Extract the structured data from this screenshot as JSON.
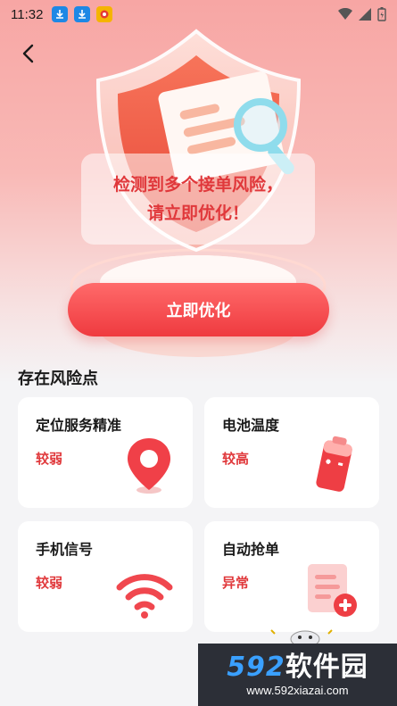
{
  "status_bar": {
    "time": "11:32",
    "icons": [
      "download-icon",
      "download-icon",
      "app-icon",
      "wifi-icon",
      "signal-icon",
      "battery-icon"
    ]
  },
  "hero": {
    "warning_line1": "检测到多个接单风险，",
    "warning_line2": "请立即优化！",
    "cta_label": "立即优化"
  },
  "section": {
    "title": "存在风险点"
  },
  "cards": [
    {
      "title": "定位服务精准",
      "status": "较弱",
      "icon": "location-pin-icon"
    },
    {
      "title": "电池温度",
      "status": "较高",
      "icon": "battery-icon"
    },
    {
      "title": "手机信号",
      "status": "较弱",
      "icon": "wifi-signal-icon"
    },
    {
      "title": "自动抢单",
      "status": "异常",
      "icon": "document-add-icon"
    }
  ],
  "watermark": {
    "brand_num": "592",
    "brand_text": "软件园",
    "url": "www.592xiazai.com"
  },
  "colors": {
    "accent": "#e0383b",
    "cta": "#ef3a3f",
    "hero_top": "#f7a6a4"
  }
}
